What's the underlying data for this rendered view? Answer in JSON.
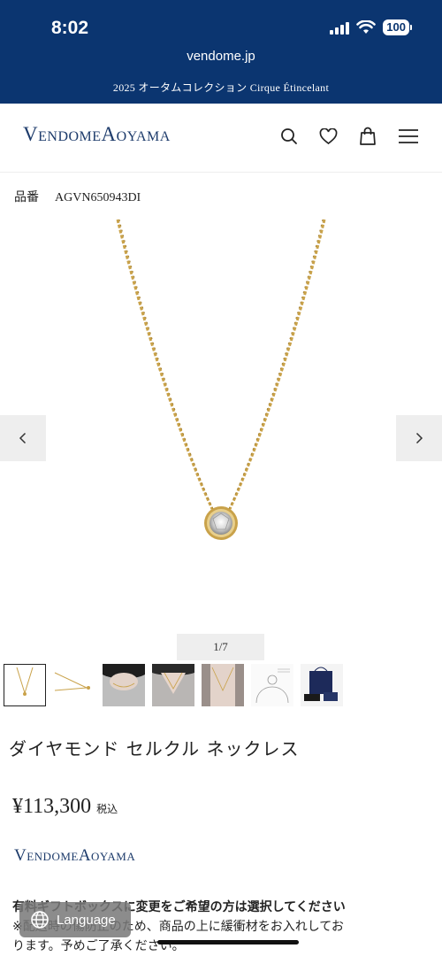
{
  "status": {
    "time": "8:02",
    "battery": "100"
  },
  "browser": {
    "url": "vendome.jp"
  },
  "promo": {
    "text": "2025 オータムコレクション Cirque Étincelant"
  },
  "header": {
    "logo": "VendomeAoyama"
  },
  "product": {
    "code_label": "品番",
    "code": "AGVN650943DI",
    "image_counter": "1/7",
    "title": "ダイヤモンド セルクル ネックレス",
    "price": "¥113,300",
    "tax_label": "税込",
    "brand": "VendomeAoyama"
  },
  "notice": {
    "line1": "有料ギフトボックスに変更をご希望の方は選択してください",
    "line2": "※配送時の傷防止のため、商品の上に緩衝材をお入れしてお",
    "line3": "ります。予めご了承ください。"
  },
  "language_button": {
    "label": "Language"
  },
  "colors": {
    "brand_navy": "#0b3570",
    "logo_navy": "#1d3b6b",
    "gold": "#c9a24a"
  }
}
